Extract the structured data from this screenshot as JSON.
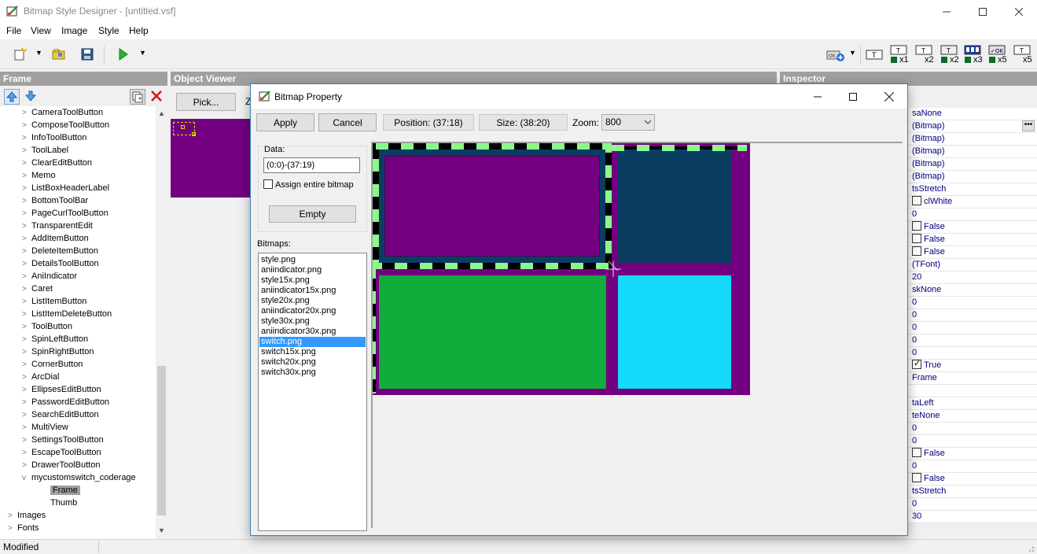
{
  "window": {
    "title": "Bitmap Style Designer - [untitled.vsf]"
  },
  "menu": [
    "File",
    "View",
    "Image",
    "Style",
    "Help"
  ],
  "toolbar_right": [
    "x1",
    "x2",
    "x2",
    "x3",
    "x5",
    "x5"
  ],
  "panels": {
    "frame": "Frame",
    "viewer": "Object Viewer",
    "inspector": "Inspector"
  },
  "viewer": {
    "pick_label": "Pick...",
    "zoom_prefix": "Z"
  },
  "tree": {
    "items": [
      {
        "label": "CameraToolButton",
        "level": 1,
        "chev": ">"
      },
      {
        "label": "ComposeToolButton",
        "level": 1,
        "chev": ">"
      },
      {
        "label": "InfoToolButton",
        "level": 1,
        "chev": ">"
      },
      {
        "label": "ToolLabel",
        "level": 1,
        "chev": ">"
      },
      {
        "label": "ClearEditButton",
        "level": 1,
        "chev": ">"
      },
      {
        "label": "Memo",
        "level": 1,
        "chev": ">"
      },
      {
        "label": "ListBoxHeaderLabel",
        "level": 1,
        "chev": ">"
      },
      {
        "label": "BottomToolBar",
        "level": 1,
        "chev": ">"
      },
      {
        "label": "PageCurlToolButton",
        "level": 1,
        "chev": ">"
      },
      {
        "label": "TransparentEdit",
        "level": 1,
        "chev": ">"
      },
      {
        "label": "AddItemButton",
        "level": 1,
        "chev": ">"
      },
      {
        "label": "DeleteItemButton",
        "level": 1,
        "chev": ">"
      },
      {
        "label": "DetailsToolButton",
        "level": 1,
        "chev": ">"
      },
      {
        "label": "AniIndicator",
        "level": 1,
        "chev": ">"
      },
      {
        "label": "Caret",
        "level": 1,
        "chev": ">"
      },
      {
        "label": "ListItemButton",
        "level": 1,
        "chev": ">"
      },
      {
        "label": "ListItemDeleteButton",
        "level": 1,
        "chev": ">"
      },
      {
        "label": "ToolButton",
        "level": 1,
        "chev": ">"
      },
      {
        "label": "SpinLeftButton",
        "level": 1,
        "chev": ">"
      },
      {
        "label": "SpinRightButton",
        "level": 1,
        "chev": ">"
      },
      {
        "label": "CornerButton",
        "level": 1,
        "chev": ">"
      },
      {
        "label": "ArcDial",
        "level": 1,
        "chev": ">"
      },
      {
        "label": "EllipsesEditButton",
        "level": 1,
        "chev": ">"
      },
      {
        "label": "PasswordEditButton",
        "level": 1,
        "chev": ">"
      },
      {
        "label": "SearchEditButton",
        "level": 1,
        "chev": ">"
      },
      {
        "label": "MultiView",
        "level": 1,
        "chev": ">"
      },
      {
        "label": "SettingsToolButton",
        "level": 1,
        "chev": ">"
      },
      {
        "label": "EscapeToolButton",
        "level": 1,
        "chev": ">"
      },
      {
        "label": "DrawerToolButton",
        "level": 1,
        "chev": ">"
      },
      {
        "label": "mycustomswitch_coderage",
        "level": 1,
        "chev": "v"
      },
      {
        "label": "Frame",
        "level": 2,
        "chev": "",
        "selected": true
      },
      {
        "label": "Thumb",
        "level": 2,
        "chev": ""
      },
      {
        "label": "Images",
        "level": 0,
        "chev": ">"
      },
      {
        "label": "Fonts",
        "level": 0,
        "chev": ">"
      }
    ]
  },
  "inspector": {
    "values": [
      {
        "text": "saNone"
      },
      {
        "text": "(Bitmap)",
        "ellipsis": true
      },
      {
        "text": "(Bitmap)"
      },
      {
        "text": "(Bitmap)"
      },
      {
        "text": "(Bitmap)"
      },
      {
        "text": "(Bitmap)"
      },
      {
        "text": "tsStretch"
      },
      {
        "text": "clWhite",
        "check": false
      },
      {
        "text": "0"
      },
      {
        "text": "False",
        "check": false
      },
      {
        "text": "False",
        "check": false
      },
      {
        "text": "False",
        "check": false
      },
      {
        "text": "(TFont)"
      },
      {
        "text": "20"
      },
      {
        "text": "skNone"
      },
      {
        "text": "0"
      },
      {
        "text": "0"
      },
      {
        "text": "0"
      },
      {
        "text": "0"
      },
      {
        "text": "0"
      },
      {
        "text": "True",
        "check": true
      },
      {
        "text": "Frame"
      },
      {
        "text": ""
      },
      {
        "text": "taLeft"
      },
      {
        "text": "teNone"
      },
      {
        "text": "0"
      },
      {
        "text": "0"
      },
      {
        "text": "False",
        "check": false
      },
      {
        "text": "0"
      },
      {
        "text": "False",
        "check": false
      },
      {
        "text": "tsStretch"
      },
      {
        "text": "0"
      },
      {
        "text": "30"
      }
    ]
  },
  "status": {
    "text": "Modified"
  },
  "dialog": {
    "title": "Bitmap Property",
    "apply": "Apply",
    "cancel": "Cancel",
    "position": "Position: (37:18)",
    "size": "Size: (38:20)",
    "zoom_label": "Zoom:",
    "zoom_value": "800",
    "data_label": "Data:",
    "data_value": "(0:0)-(37:19)",
    "assign_label": "Assign entire bitmap",
    "empty_label": "Empty",
    "bitmaps_label": "Bitmaps:",
    "bitmaps": [
      "style.png",
      "aniindicator.png",
      "style15x.png",
      "aniindicator15x.png",
      "style20x.png",
      "aniindicator20x.png",
      "style30x.png",
      "aniindicator30x.png",
      "switch.png",
      "switch15x.png",
      "switch20x.png",
      "switch30x.png"
    ],
    "selected_bitmap": "switch.png"
  },
  "colors": {
    "purple": "#720080",
    "navy": "#0b3d63",
    "green": "#11ac3c",
    "cyan": "#14d9f9",
    "lightgreen": "#8cf78c",
    "selection": "#3399ff"
  }
}
